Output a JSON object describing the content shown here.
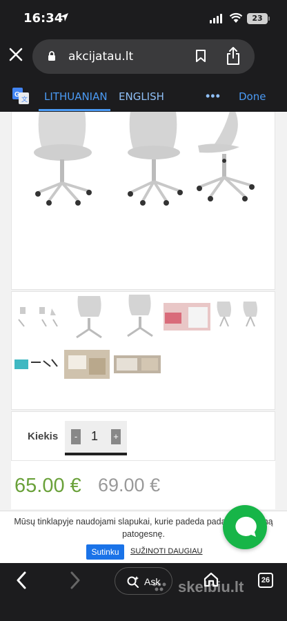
{
  "status_bar": {
    "time": "16:34",
    "battery": "23"
  },
  "browser": {
    "url": "akcijatau.lt"
  },
  "translate_bar": {
    "lang_source": "LITHUANIAN",
    "lang_target": "ENGLISH",
    "more": "•••",
    "done_label": "Done"
  },
  "product": {
    "quantity_label": "Kiekis",
    "qty_minus": "-",
    "qty_plus": "+",
    "quantity_value": "1",
    "price_current": "65.00 €",
    "price_old": "69.00 €"
  },
  "cookie_banner": {
    "text": "Mūsų tinklapyje naudojami slapukai, kurie padeda padaryti naršymą patogesnę.",
    "accept_label": "Sutinku",
    "more_label": "SUŽINOTI DAUGIAU"
  },
  "bottom_toolbar": {
    "ask_label": "Ask",
    "tab_count": "26",
    "watermark": "skelbiu.lt"
  },
  "colors": {
    "accent_blue": "#4b9bf5",
    "price_green": "#6aa13a",
    "chat_green": "#17b548",
    "toolbar_bg": "#1c1c1e"
  }
}
